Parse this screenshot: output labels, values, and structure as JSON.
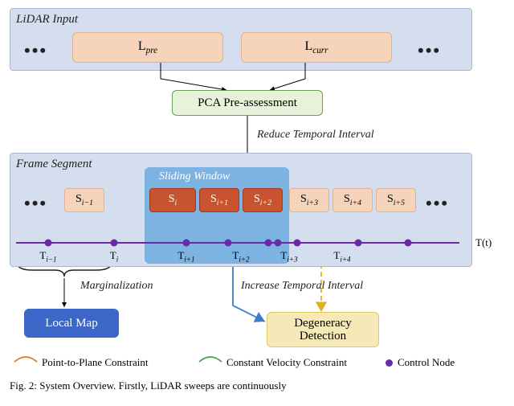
{
  "panels": {
    "input_title": "LiDAR Input",
    "segment_title": "Frame Segment"
  },
  "lidar": {
    "pre": "L",
    "pre_sub": "pre",
    "curr": "L",
    "curr_sub": "curr"
  },
  "pca": "PCA Pre-assessment",
  "labels": {
    "reduce": "Reduce Temporal Interval",
    "sliding": "Sliding Window",
    "increase": "Increase Temporal Interval",
    "marginalization": "Marginalization",
    "timeline": "T(t)"
  },
  "segments": {
    "items": [
      {
        "l": "S",
        "s": "i−1"
      },
      {
        "l": "S",
        "s": "i"
      },
      {
        "l": "S",
        "s": "i+1"
      },
      {
        "l": "S",
        "s": "i+2"
      },
      {
        "l": "S",
        "s": "i+3"
      },
      {
        "l": "S",
        "s": "i+4"
      },
      {
        "l": "S",
        "s": "i+5"
      }
    ]
  },
  "ticks": [
    {
      "l": "T",
      "s": "i−1"
    },
    {
      "l": "T",
      "s": "i"
    },
    {
      "l": "T",
      "s": "i+1"
    },
    {
      "l": "T",
      "s": "i+2"
    },
    {
      "l": "T",
      "s": "i+3"
    },
    {
      "l": "T",
      "s": "i+4"
    }
  ],
  "boxes": {
    "localmap": "Local Map",
    "degen_a": "Degeneracy",
    "degen_b": "Detection"
  },
  "legend": {
    "ptp": "Point-to-Plane Constraint",
    "cvc": "Constant Velocity Constraint",
    "cn": "Control Node"
  },
  "caption": {
    "fig": "Fig. 2:",
    "rest": " System Overview. Firstly, LiDAR sweeps are continuously"
  },
  "colors": {
    "orange_arc": "#d97a2a",
    "green_arc": "#4aa048",
    "purple": "#6a2aa8",
    "blue_arrow": "#3c7cc8",
    "yellow_dash": "#e0b020"
  }
}
